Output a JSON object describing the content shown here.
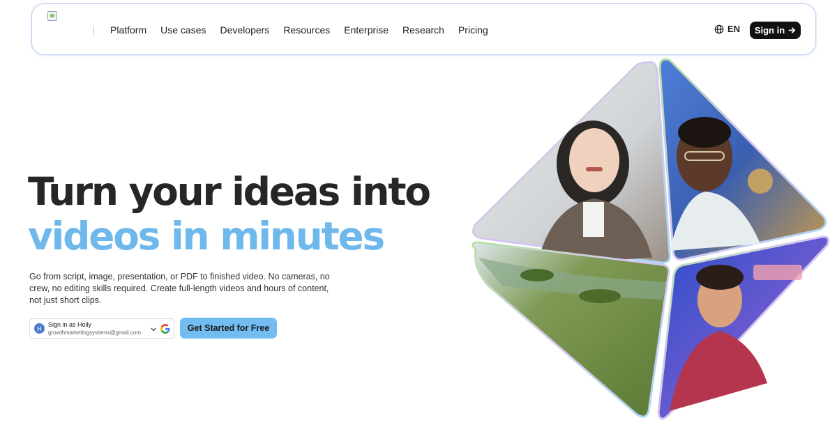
{
  "nav": {
    "links": [
      "Platform",
      "Use cases",
      "Developers",
      "Resources",
      "Enterprise",
      "Research",
      "Pricing"
    ],
    "language": "EN",
    "signin_label": "Sign in"
  },
  "hero": {
    "headline_line1": "Turn your ideas into",
    "headline_line2": "videos in minutes",
    "subtext": "Go from script, image, presentation, or PDF to finished video. No cameras, no crew, no editing skills required. Create full-length videos and hours of content, not just short clips.",
    "google_signin": {
      "avatar_initial": "H",
      "name": "Sign in as Holly",
      "email": "growthmarketingsystems@gmail.com"
    },
    "cta_label": "Get Started for Free"
  },
  "colors": {
    "headline_dark": "#262626",
    "headline_accent": "#6fb8ec",
    "cta_bg": "#72bcf2",
    "signin_bg": "#111111"
  },
  "icons": {
    "language": "globe-icon",
    "signin_arrow": "arrow-right-icon",
    "chip_dropdown": "chevron-down-icon",
    "google": "google-g-icon"
  }
}
